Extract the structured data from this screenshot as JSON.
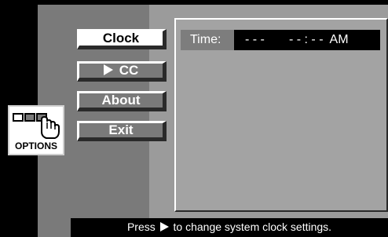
{
  "menu": {
    "items": [
      {
        "label": "Clock",
        "state": "selected"
      },
      {
        "label": "CC",
        "state": "normal",
        "prefix_icon": "play-arrow-icon"
      },
      {
        "label": "About",
        "state": "normal"
      },
      {
        "label": "Exit",
        "state": "normal"
      }
    ]
  },
  "options_tile": {
    "label": "OPTIONS",
    "icon": "options-hand-icon"
  },
  "clock_panel": {
    "time_label": "Time:",
    "time_value": "- - -       - - : - -  AM"
  },
  "status_bar": {
    "prefix": "Press",
    "arrow_icon": "play-arrow-icon",
    "suffix": "to change system clock settings."
  },
  "colors": {
    "background": "#000000",
    "left_panel": "#7a7a7a",
    "right_area": "#9b9b9b",
    "content_panel": "#a3a3a3",
    "selected_button": "#ffffff",
    "text": "#ffffff"
  }
}
